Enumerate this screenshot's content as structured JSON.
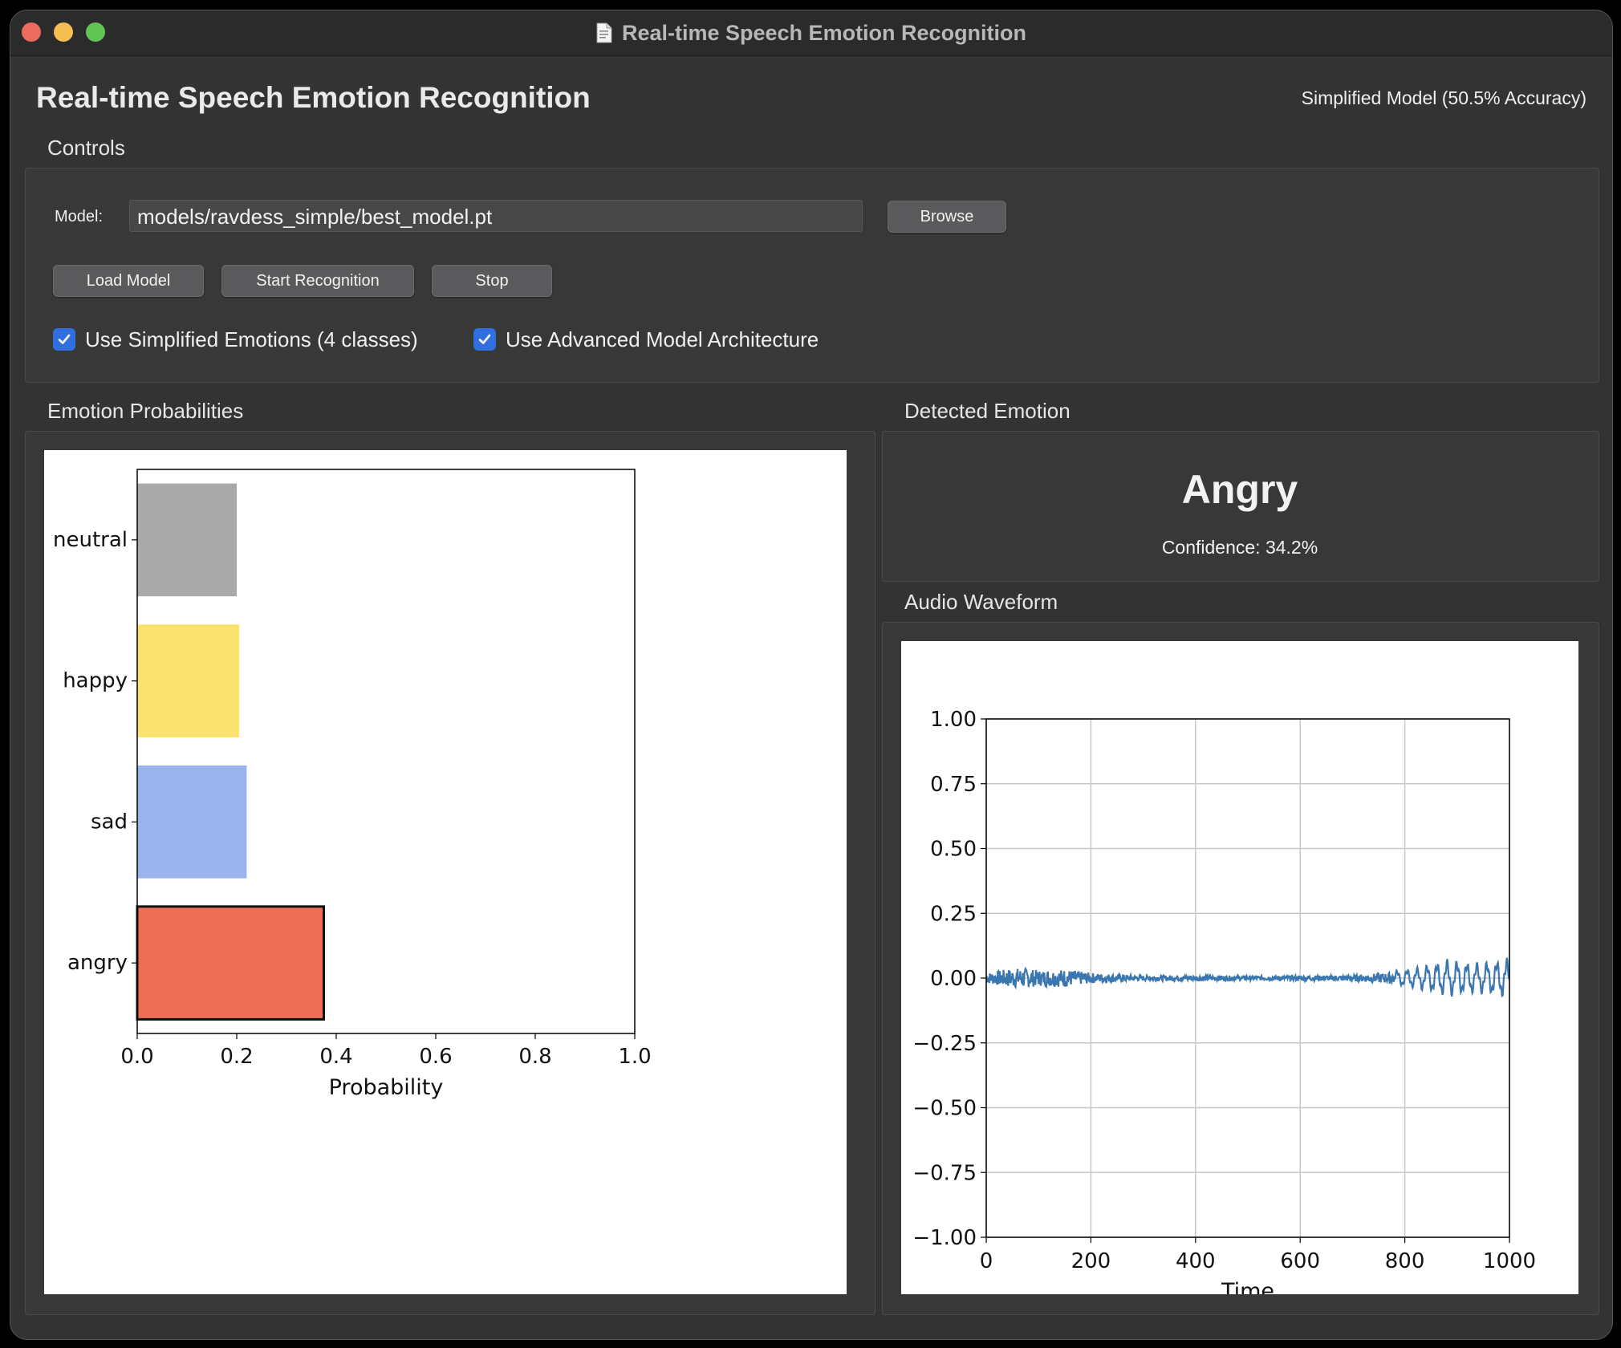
{
  "window": {
    "title": "Real-time Speech Emotion Recognition",
    "heading": "Real-time Speech Emotion Recognition",
    "model_status": "Simplified Model (50.5% Accuracy)"
  },
  "controls": {
    "group_title": "Controls",
    "model_label": "Model:",
    "model_path": "models/ravdess_simple/best_model.pt",
    "browse_label": "Browse",
    "load_label": "Load Model",
    "start_label": "Start Recognition",
    "stop_label": "Stop",
    "simplified_label": "Use Simplified Emotions (4 classes)",
    "simplified_checked": true,
    "advanced_label": "Use Advanced Model Architecture",
    "advanced_checked": true
  },
  "probabilities": {
    "group_title": "Emotion Probabilities"
  },
  "detected": {
    "group_title": "Detected Emotion",
    "emotion": "Angry",
    "confidence": "Confidence: 34.2%"
  },
  "waveform": {
    "group_title": "Audio Waveform"
  },
  "chart_data": [
    {
      "type": "bar",
      "orientation": "horizontal",
      "categories": [
        "neutral",
        "happy",
        "sad",
        "angry"
      ],
      "values": [
        0.2,
        0.205,
        0.22,
        0.375
      ],
      "colors": [
        "#a9a9a9",
        "#f9e26e",
        "#9bb3ec",
        "#ec6f55"
      ],
      "highlighted": "angry",
      "xlabel": "Probability",
      "xlim": [
        0,
        1
      ],
      "xticks": [
        "0.0",
        "0.2",
        "0.4",
        "0.6",
        "0.8",
        "1.0"
      ]
    },
    {
      "type": "line",
      "series_color": "#3a76b0",
      "xlabel": "Time",
      "xlim": [
        0,
        1000
      ],
      "ylim": [
        -1,
        1
      ],
      "xticks": [
        "0",
        "200",
        "400",
        "600",
        "800",
        "1000"
      ],
      "yticks": [
        "1.00",
        "0.75",
        "0.50",
        "0.25",
        "0.00",
        "−0.25",
        "−0.50",
        "−0.75",
        "−1.00"
      ],
      "grid": true,
      "noise_amplitude": [
        [
          0,
          0.02
        ],
        [
          40,
          0.035
        ],
        [
          70,
          0.04
        ],
        [
          100,
          0.03
        ],
        [
          150,
          0.035
        ],
        [
          200,
          0.02
        ],
        [
          300,
          0.01
        ],
        [
          400,
          0.012
        ],
        [
          500,
          0.008
        ],
        [
          600,
          0.01
        ],
        [
          700,
          0.012
        ],
        [
          760,
          0.02
        ],
        [
          820,
          0.03
        ],
        [
          880,
          0.055
        ],
        [
          940,
          0.045
        ],
        [
          1000,
          0.06
        ]
      ]
    }
  ]
}
